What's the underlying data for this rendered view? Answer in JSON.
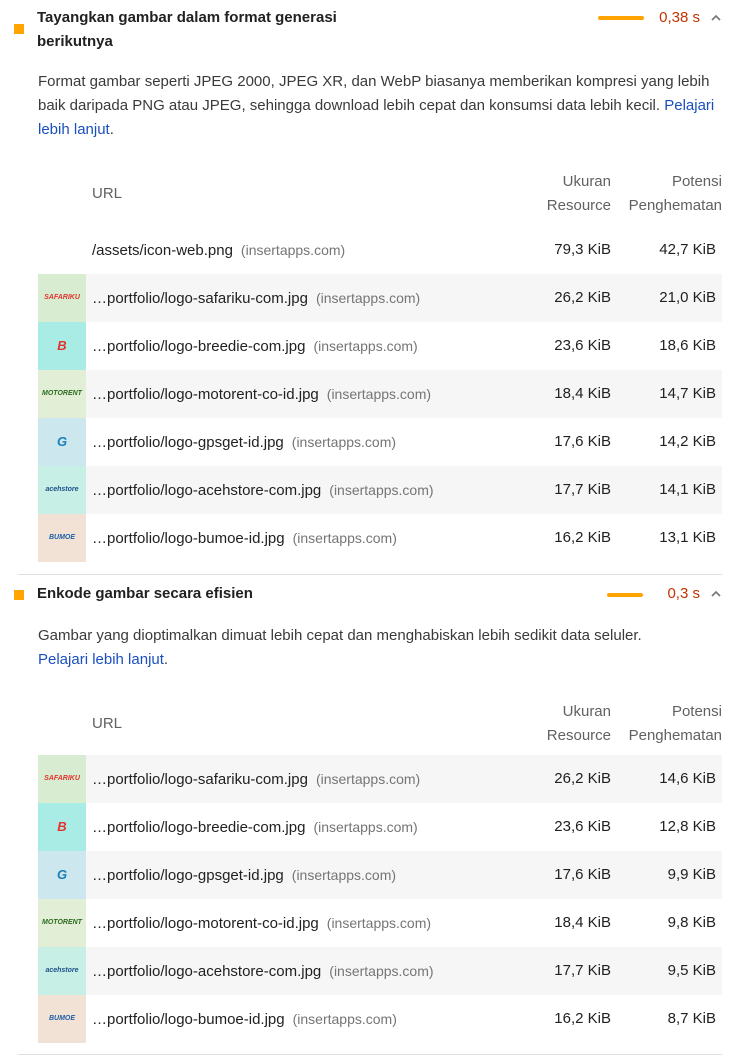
{
  "audits": [
    {
      "title_line1": "Tayangkan gambar dalam format generasi",
      "title_line2": "berikutnya",
      "value": "0,38 s",
      "bar_fraction": 0.38,
      "description": "Format gambar seperti JPEG 2000, JPEG XR, dan WebP biasanya memberikan kompresi yang lebih baik daripada PNG atau JPEG, sehingga download lebih cepat dan konsumsi data lebih kecil.",
      "learn_more": "Pelajari lebih lanjut",
      "headers": {
        "url": "URL",
        "size_line1": "Ukuran",
        "size_line2": "Resource",
        "saving_line1": "Potensi",
        "saving_line2": "Penghematan"
      },
      "rows": [
        {
          "thumb": "none",
          "url": "/assets/icon-web.png",
          "host": "(insertapps.com)",
          "size": "79,3 KiB",
          "saving": "42,7 KiB"
        },
        {
          "thumb": "safariku",
          "url": "…portfolio/logo-safariku-com.jpg",
          "host": "(insertapps.com)",
          "size": "26,2 KiB",
          "saving": "21,0 KiB"
        },
        {
          "thumb": "breedie",
          "url": "…portfolio/logo-breedie-com.jpg",
          "host": "(insertapps.com)",
          "size": "23,6 KiB",
          "saving": "18,6 KiB"
        },
        {
          "thumb": "motorent",
          "url": "…portfolio/logo-motorent-co-id.jpg",
          "host": "(insertapps.com)",
          "size": "18,4 KiB",
          "saving": "14,7 KiB"
        },
        {
          "thumb": "gpsget",
          "url": "…portfolio/logo-gpsget-id.jpg",
          "host": "(insertapps.com)",
          "size": "17,6 KiB",
          "saving": "14,2 KiB"
        },
        {
          "thumb": "acehstore",
          "url": "…portfolio/logo-acehstore-com.jpg",
          "host": "(insertapps.com)",
          "size": "17,7 KiB",
          "saving": "14,1 KiB"
        },
        {
          "thumb": "bumoe",
          "url": "…portfolio/logo-bumoe-id.jpg",
          "host": "(insertapps.com)",
          "size": "16,2 KiB",
          "saving": "13,1 KiB"
        }
      ]
    },
    {
      "title_line1": "Enkode gambar secara efisien",
      "title_line2": "",
      "value": "0,3 s",
      "bar_fraction": 0.3,
      "description": "Gambar yang dioptimalkan dimuat lebih cepat dan menghabiskan lebih sedikit data seluler.",
      "learn_more": "Pelajari lebih lanjut",
      "headers": {
        "url": "URL",
        "size_line1": "Ukuran",
        "size_line2": "Resource",
        "saving_line1": "Potensi",
        "saving_line2": "Penghematan"
      },
      "rows": [
        {
          "thumb": "safariku",
          "url": "…portfolio/logo-safariku-com.jpg",
          "host": "(insertapps.com)",
          "size": "26,2 KiB",
          "saving": "14,6 KiB"
        },
        {
          "thumb": "breedie",
          "url": "…portfolio/logo-breedie-com.jpg",
          "host": "(insertapps.com)",
          "size": "23,6 KiB",
          "saving": "12,8 KiB"
        },
        {
          "thumb": "gpsget",
          "url": "…portfolio/logo-gpsget-id.jpg",
          "host": "(insertapps.com)",
          "size": "17,6 KiB",
          "saving": "9,9 KiB"
        },
        {
          "thumb": "motorent",
          "url": "…portfolio/logo-motorent-co-id.jpg",
          "host": "(insertapps.com)",
          "size": "18,4 KiB",
          "saving": "9,8 KiB"
        },
        {
          "thumb": "acehstore",
          "url": "…portfolio/logo-acehstore-com.jpg",
          "host": "(insertapps.com)",
          "size": "17,7 KiB",
          "saving": "9,5 KiB"
        },
        {
          "thumb": "bumoe",
          "url": "…portfolio/logo-bumoe-id.jpg",
          "host": "(insertapps.com)",
          "size": "16,2 KiB",
          "saving": "8,7 KiB"
        }
      ]
    }
  ],
  "thumb_logos": {
    "safariku": {
      "text": "SAFARIKU",
      "color": "#e3342f",
      "bg": "#d7ecd0"
    },
    "breedie": {
      "text": "B",
      "color": "#e3342f",
      "bg": "#a9ece6"
    },
    "motorent": {
      "text": "MOTORENT",
      "color": "#2d6b1f",
      "bg": "#e2efd6"
    },
    "gpsget": {
      "text": "G",
      "color": "#1b7fb8",
      "bg": "#cde7ef"
    },
    "acehstore": {
      "text": "acehstore",
      "color": "#1b4f8a",
      "bg": "#c8efe6"
    },
    "bumoe": {
      "text": "BUMOE",
      "color": "#1e5fa8",
      "bg": "#f2e2d6"
    }
  }
}
